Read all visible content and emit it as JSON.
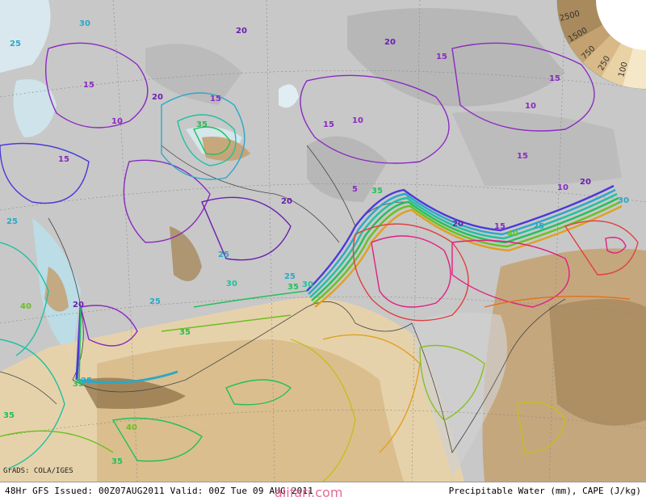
{
  "footer": {
    "left_text": "48Hr GFS Issued: 00Z07AUG2011 Valid: 00Z Tue 09 AUG 2011",
    "right_text": "Precipitable Water (mm), CAPE (J/kg)"
  },
  "credit": "GrADS: COLA/IGES",
  "watermark": "alifari.com",
  "legend": {
    "levels": [
      "2500",
      "1500",
      "750",
      "250",
      "100"
    ],
    "colors": [
      "#a88a5c",
      "#c4a170",
      "#d8b987",
      "#e9d3a6",
      "#f5e8c8"
    ]
  },
  "contour_labels": [
    {
      "text": "25",
      "color": "#2aa8c8"
    },
    {
      "text": "30",
      "color": "#2aa8c8"
    },
    {
      "text": "20",
      "color": "#6a1fb0"
    },
    {
      "text": "15",
      "color": "#8a2ac0"
    },
    {
      "text": "10",
      "color": "#8a2ac0"
    },
    {
      "text": "35",
      "color": "#22c05a"
    },
    {
      "text": "40",
      "color": "#6ac020"
    },
    {
      "text": "5",
      "color": "#8a2ac0"
    }
  ],
  "colors": {
    "ocean": "#cfe7f0",
    "land": "#c9c9c9",
    "pw10": "#8a2ac0",
    "pw20": "#4a3ad8",
    "pw25": "#2aa8c8",
    "pw30": "#22c0a0",
    "pw35": "#22c05a",
    "pw40": "#6ac020",
    "pw50": "#e0a020",
    "pw60": "#e04040",
    "pw70": "#e02080"
  }
}
